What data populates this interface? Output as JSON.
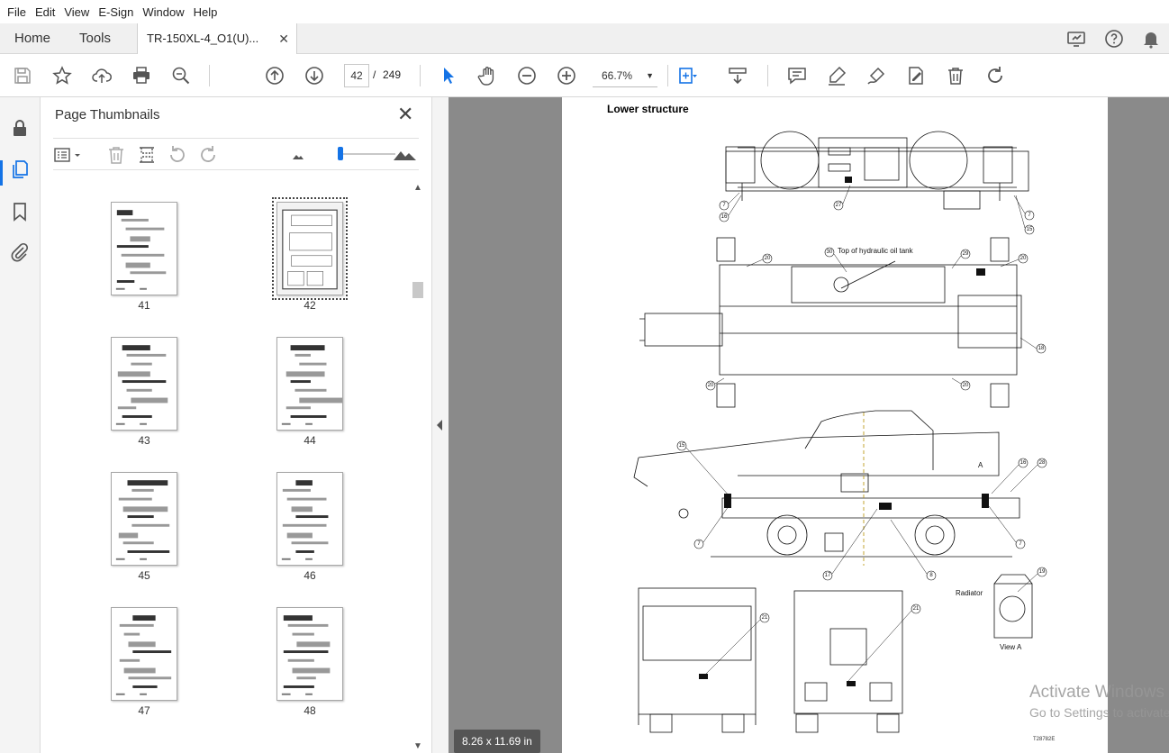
{
  "menu": {
    "file": "File",
    "edit": "Edit",
    "view": "View",
    "esign": "E-Sign",
    "window": "Window",
    "help": "Help"
  },
  "tabs": {
    "home": "Home",
    "tools": "Tools",
    "document": "TR-150XL-4_O1(U)...",
    "close": "✕"
  },
  "toolbar": {
    "page_current": "42",
    "page_separator": "/",
    "page_total": "249",
    "zoom": "66.7%"
  },
  "thumbnails_panel": {
    "title": "Page Thumbnails",
    "close": "✕",
    "thumbnails": [
      {
        "label": "41"
      },
      {
        "label": "42",
        "selected": true
      },
      {
        "label": "43"
      },
      {
        "label": "44"
      },
      {
        "label": "45"
      },
      {
        "label": "46"
      },
      {
        "label": "47"
      },
      {
        "label": "48"
      }
    ]
  },
  "document_page": {
    "heading": "Lower structure",
    "tank_callout": "Top of hydraulic oil tank",
    "radiator_callout": "Radiator",
    "view_label": "View A",
    "section_marker": "A",
    "callout_numbers": [
      "7",
      "16",
      "27",
      "7",
      "15",
      "20",
      "30",
      "29",
      "20",
      "18",
      "20",
      "20",
      "15",
      "16",
      "28",
      "7",
      "7",
      "17",
      "8",
      "19",
      "21",
      "21"
    ],
    "figure_code": "T28782E"
  },
  "page_size": "8.26 x 11.69 in",
  "watermark": {
    "line1": "Activate Windows",
    "line2": "Go to Settings to activate Windows."
  },
  "colors": {
    "accent": "#1473e6",
    "viewer_background": "#8a8a8a"
  }
}
